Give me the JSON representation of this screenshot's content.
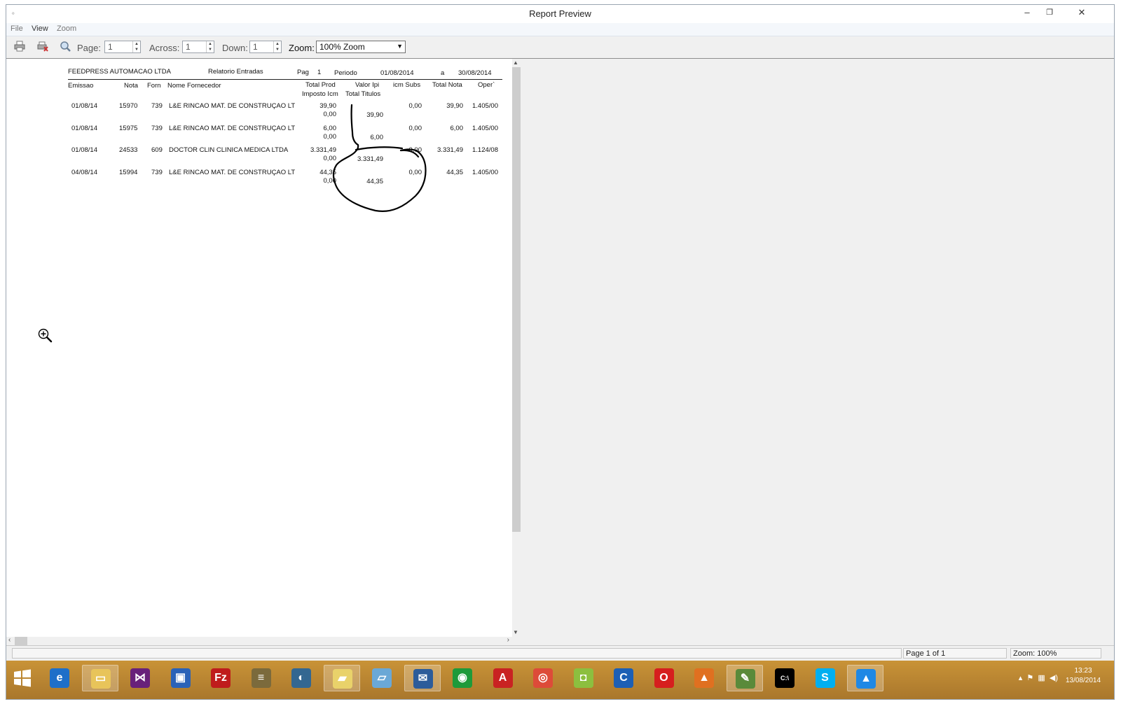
{
  "window": {
    "title": "Report Preview",
    "minimize_glyph": "–",
    "maximize_glyph": "❐",
    "close_glyph": "✕"
  },
  "menu": {
    "items": [
      "File",
      "View",
      "Zoom"
    ]
  },
  "toolbar": {
    "page_label": "Page:",
    "page_value": "1",
    "across_label": "Across:",
    "across_value": "1",
    "down_label": "Down:",
    "down_value": "1",
    "zoom_label": "Zoom:",
    "zoom_value": "100% Zoom",
    "icons": [
      "printer-icon",
      "printer-setup-icon",
      "find-icon"
    ]
  },
  "report": {
    "company": "FEEDPRESS AUTOMACAO LTDA",
    "title": "Relatorio  Entradas",
    "pag_label": "Pag",
    "pag_value": "1",
    "periodo_label": "Periodo",
    "date_from": "01/08/2014",
    "a_label": "a",
    "date_to": "30/08/2014",
    "headers": {
      "emissao": "Emissao",
      "nota": "Nota",
      "forn": "Forn",
      "nome": "Nome Fornecedor",
      "total_prod": "Total Prod",
      "imposto_icm": "Imposto Icm",
      "valor_ipi": "Valor Ipi",
      "total_titulos": "Total Titulos",
      "icm_subs": "icm Subs",
      "total_nota": "Total Nota",
      "oper": "Oper`"
    },
    "rows": [
      {
        "emissao": "01/08/14",
        "nota": "15970",
        "forn": "739",
        "nome": "L&E RINCAO MAT. DE CONSTRUÇAO LT",
        "total_prod": "39,90",
        "imposto_icm": "0,00",
        "total_titulos": "39,90",
        "icm_subs": "0,00",
        "total_nota": "39,90",
        "oper": "1.405/00"
      },
      {
        "emissao": "01/08/14",
        "nota": "15975",
        "forn": "739",
        "nome": "L&E RINCAO MAT. DE CONSTRUÇAO LT",
        "total_prod": "6,00",
        "imposto_icm": "0,00",
        "total_titulos": "6,00",
        "icm_subs": "0,00",
        "total_nota": "6,00",
        "oper": "1.405/00"
      },
      {
        "emissao": "01/08/14",
        "nota": "24533",
        "forn": "609",
        "nome": "DOCTOR CLIN CLINICA MEDICA LTDA",
        "total_prod": "3.331,49",
        "imposto_icm": "0,00",
        "total_titulos": "3.331,49",
        "icm_subs": "0,00",
        "total_nota": "3.331,49",
        "oper": "1.124/08"
      },
      {
        "emissao": "04/08/14",
        "nota": "15994",
        "forn": "739",
        "nome": "L&E RINCAO MAT. DE CONSTRUÇAO LT",
        "total_prod": "44,35",
        "imposto_icm": "0,00",
        "total_titulos": "44,35",
        "icm_subs": "0,00",
        "total_nota": "44,35",
        "oper": "1.405/00"
      }
    ]
  },
  "statusbar": {
    "page_info": "Page 1 of 1",
    "zoom_info": "Zoom: 100%"
  },
  "taskbar": {
    "apps": [
      {
        "name": "internet-explorer",
        "color": "#1e6fc9",
        "glyph": "e",
        "active": false
      },
      {
        "name": "file-explorer",
        "color": "#e8c45a",
        "glyph": "▭",
        "active": true
      },
      {
        "name": "visual-studio",
        "color": "#68217a",
        "glyph": "⋈",
        "active": false
      },
      {
        "name": "remote-desktop",
        "color": "#2a62b8",
        "glyph": "▣",
        "active": false
      },
      {
        "name": "filezilla",
        "color": "#bf1c1c",
        "glyph": "Fz",
        "active": false
      },
      {
        "name": "tool-app",
        "color": "#7b6a3c",
        "glyph": "≡",
        "active": false
      },
      {
        "name": "postgresql",
        "color": "#336791",
        "glyph": "◐",
        "active": false
      },
      {
        "name": "sticky-notes",
        "color": "#e9d26a",
        "glyph": "▰",
        "active": true
      },
      {
        "name": "notes-app",
        "color": "#6aa8d6",
        "glyph": "▱",
        "active": false
      },
      {
        "name": "thunderbird",
        "color": "#2c5c9a",
        "glyph": "✉",
        "active": true
      },
      {
        "name": "viewer-app",
        "color": "#1e9a3a",
        "glyph": "◉",
        "active": false
      },
      {
        "name": "acrobat",
        "color": "#c92222",
        "glyph": "A",
        "active": false
      },
      {
        "name": "chrome",
        "color": "#dd4b39",
        "glyph": "◎",
        "active": false
      },
      {
        "name": "android-sdk",
        "color": "#8cbf3f",
        "glyph": "◘",
        "active": false
      },
      {
        "name": "ccleaner",
        "color": "#1c5fb5",
        "glyph": "C",
        "active": false
      },
      {
        "name": "opera",
        "color": "#d61e1e",
        "glyph": "O",
        "active": false
      },
      {
        "name": "delphi-app",
        "color": "#e07020",
        "glyph": "▲",
        "active": false
      },
      {
        "name": "chart-app",
        "color": "#5a8a3a",
        "glyph": "✎",
        "active": true
      },
      {
        "name": "command-prompt",
        "color": "#000000",
        "glyph": "C:\\",
        "active": false
      },
      {
        "name": "skype",
        "color": "#00aff0",
        "glyph": "S",
        "active": false
      },
      {
        "name": "azure-app",
        "color": "#1e88e5",
        "glyph": "▲",
        "active": true
      }
    ],
    "time": "13:23",
    "date": "13/08/2014"
  }
}
